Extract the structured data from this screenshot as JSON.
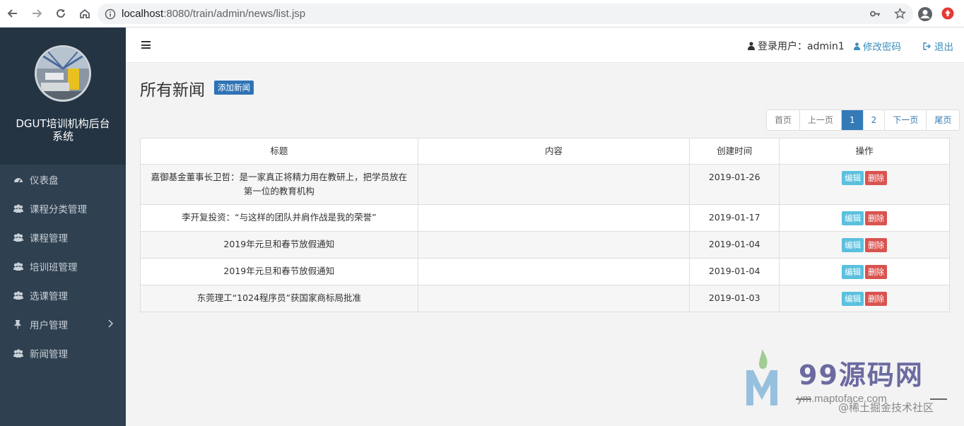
{
  "browser": {
    "url_host": "localhost",
    "url_path": ":8080/train/admin/news/list.jsp"
  },
  "sidebar": {
    "system_title": "DGUT培训机构后台系统",
    "items": [
      {
        "label": "仪表盘",
        "icon": "dashboard-icon"
      },
      {
        "label": "课程分类管理",
        "icon": "users-icon"
      },
      {
        "label": "课程管理",
        "icon": "users-icon"
      },
      {
        "label": "培训班管理",
        "icon": "users-icon"
      },
      {
        "label": "选课管理",
        "icon": "users-icon"
      },
      {
        "label": "用户管理",
        "icon": "pin-icon"
      },
      {
        "label": "新闻管理",
        "icon": "users-icon"
      }
    ]
  },
  "topbar": {
    "user_label": "登录用户：admin1",
    "change_password": "修改密码",
    "logout": "退出"
  },
  "main": {
    "title": "所有新闻",
    "add_button": "添加新闻",
    "pagination": [
      "首页",
      "上一页",
      "1",
      "2",
      "下一页",
      "尾页"
    ],
    "pagination_active": "1",
    "table": {
      "headers": [
        "标题",
        "内容",
        "创建时间",
        "操作"
      ],
      "rows": [
        {
          "title": "嘉御基金董事长卫哲：是一家真正将精力用在教研上，把学员放在第一位的教育机构",
          "content": "",
          "date": "2019-01-26"
        },
        {
          "title": "李开复投资：“与这样的团队并肩作战是我的荣誉”",
          "content": "",
          "date": "2019-01-17"
        },
        {
          "title": "2019年元旦和春节放假通知",
          "content": "",
          "date": "2019-01-04"
        },
        {
          "title": "2019年元旦和春节放假通知",
          "content": "",
          "date": "2019-01-04"
        },
        {
          "title": "东莞理工“1024程序员”获国家商标局批准",
          "content": "",
          "date": "2019-01-03"
        }
      ],
      "edit_label": "编辑",
      "delete_label": "删除"
    }
  },
  "watermark": {
    "brand": "99源码网",
    "url": "ym.maptoface.com",
    "juejin": "@稀土掘金技术社区"
  },
  "colors": {
    "sidebar_bg": "#2f4050",
    "primary": "#337ab7",
    "info": "#5bc0de",
    "danger": "#d9534f"
  }
}
